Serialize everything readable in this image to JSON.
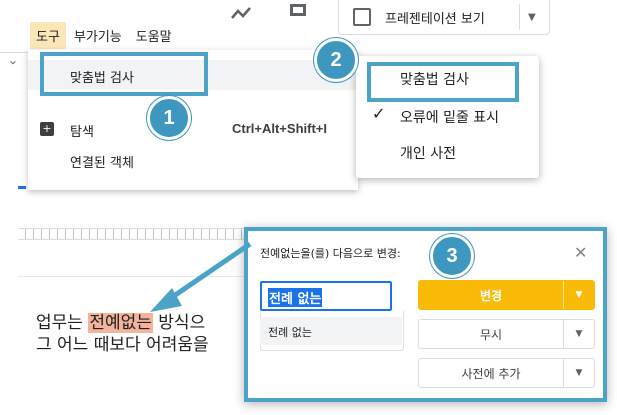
{
  "menubar": {
    "items": [
      "도구",
      "부가기능",
      "도움말"
    ]
  },
  "toolbar": {
    "edit_mode_label": "프레젠테이션 보기"
  },
  "tools_menu": {
    "spell_check": "맞춤법 검사",
    "explore": "탐색",
    "explore_shortcut": "Ctrl+Alt+Shift+I",
    "linked_objects": "연결된 객체"
  },
  "spell_submenu": {
    "spell_check": "맞춤법 검사",
    "show_underline": "오류에 밑줄 표시",
    "personal_dictionary": "개인 사전"
  },
  "badges": [
    "1",
    "2",
    "3"
  ],
  "document": {
    "line1_before": "업무는 ",
    "line1_error": "전예없는",
    "line1_after": " 방식으",
    "line2": "그 어느 때보다 어려움을"
  },
  "spell_dialog": {
    "title": "전예없는을(를) 다음으로 변경:",
    "input_value": "전례 없는",
    "suggestion": "전례 없는",
    "change_button": "변경",
    "ignore_button": "무시",
    "add_to_dictionary_button": "사전에 추가"
  },
  "colors": {
    "highlight_border": "#4ba3c7",
    "badge": "#3d97be",
    "change_button": "#f9bb06",
    "error_highlight": "#f4b49c",
    "accent_blue": "#1a73e8"
  }
}
